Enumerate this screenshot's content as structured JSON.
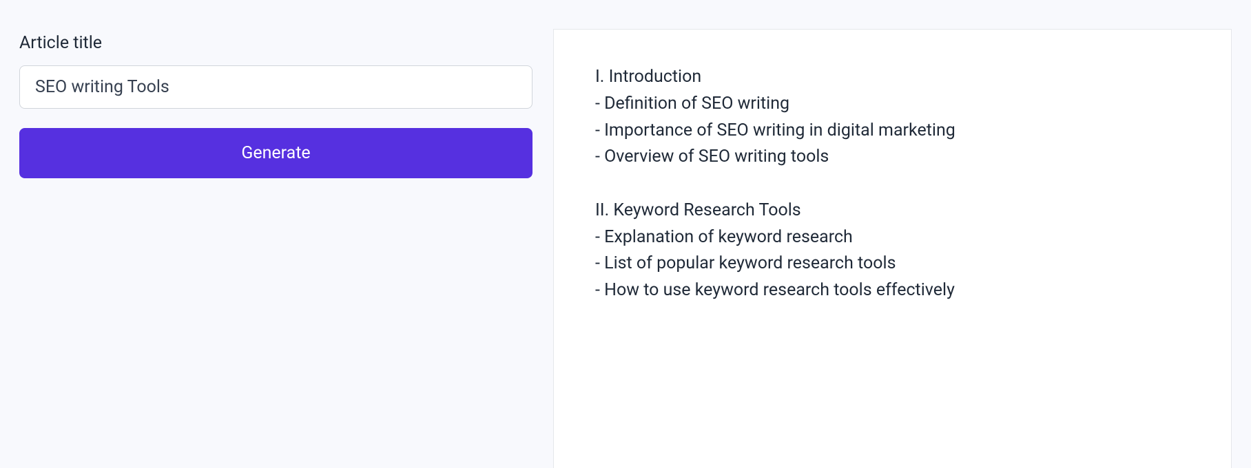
{
  "form": {
    "title_label": "Article title",
    "title_value": "SEO writing Tools",
    "generate_button_label": "Generate"
  },
  "output": {
    "outline_text": "I. Introduction\n- Definition of SEO writing\n- Importance of SEO writing in digital marketing\n- Overview of SEO writing tools\n\nII. Keyword Research Tools\n- Explanation of keyword research\n- List of popular keyword research tools\n- How to use keyword research tools effectively"
  }
}
